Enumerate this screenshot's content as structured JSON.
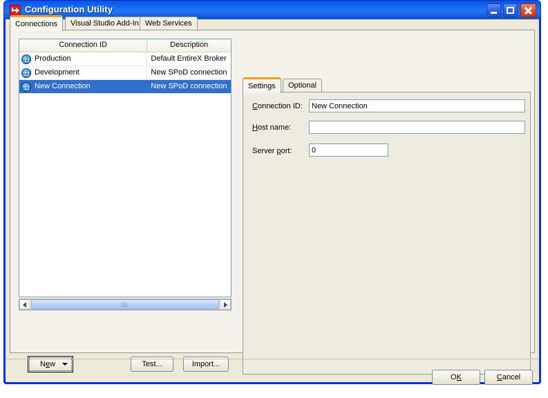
{
  "window": {
    "title": "Configuration Utility",
    "icon": "app-arrow-icon",
    "titlebar_color": "#0f62ef",
    "border_color": "#0831d9",
    "controls": {
      "minimize": "minimize-icon",
      "maximize": "maximize-icon",
      "close": "close-icon"
    }
  },
  "outer_tabs": [
    {
      "label": "Connections",
      "active": true
    },
    {
      "label": "Visual Studio Add-In",
      "active": false
    },
    {
      "label": "Web Services",
      "active": false
    }
  ],
  "list": {
    "columns": [
      "Connection ID",
      "Description"
    ],
    "rows": [
      {
        "icon": "globe-icon",
        "id": "Production",
        "description": "Default EntireX Broker",
        "selected": false
      },
      {
        "icon": "globe-icon",
        "id": "Development",
        "description": "New SPoD connection",
        "selected": false
      },
      {
        "icon": "globe-icon",
        "id": "New Connection",
        "description": "New SPoD connection",
        "selected": true
      }
    ],
    "selection_color": "#2f6fcd"
  },
  "scrollbar": {
    "left_arrow": "chevron-left-icon",
    "right_arrow": "chevron-right-icon",
    "grip": "grip-icon"
  },
  "left_buttons": {
    "new": {
      "pre": "N",
      "acc": "e",
      "post": "w",
      "label": "New",
      "dropdown": "chevron-down-icon",
      "focused": true
    },
    "test": "Test...",
    "import": "Import..."
  },
  "right_tabs": [
    {
      "label": "Settings",
      "active": true
    },
    {
      "label": "Optional",
      "active": false
    }
  ],
  "settings": {
    "connection_id": {
      "pre": "",
      "acc": "C",
      "post": "onnection ID:",
      "value": "New Connection",
      "placeholder": ""
    },
    "host_name": {
      "pre": "",
      "acc": "H",
      "post": "ost name:",
      "value": "",
      "placeholder": ""
    },
    "server_port": {
      "pre": "Server ",
      "acc": "p",
      "post": "ort:",
      "value": "0",
      "placeholder": ""
    }
  },
  "footer": {
    "ok": {
      "pre": "O",
      "acc": "K",
      "post": ""
    },
    "cancel": {
      "pre": "",
      "acc": "C",
      "post": "ancel"
    }
  }
}
